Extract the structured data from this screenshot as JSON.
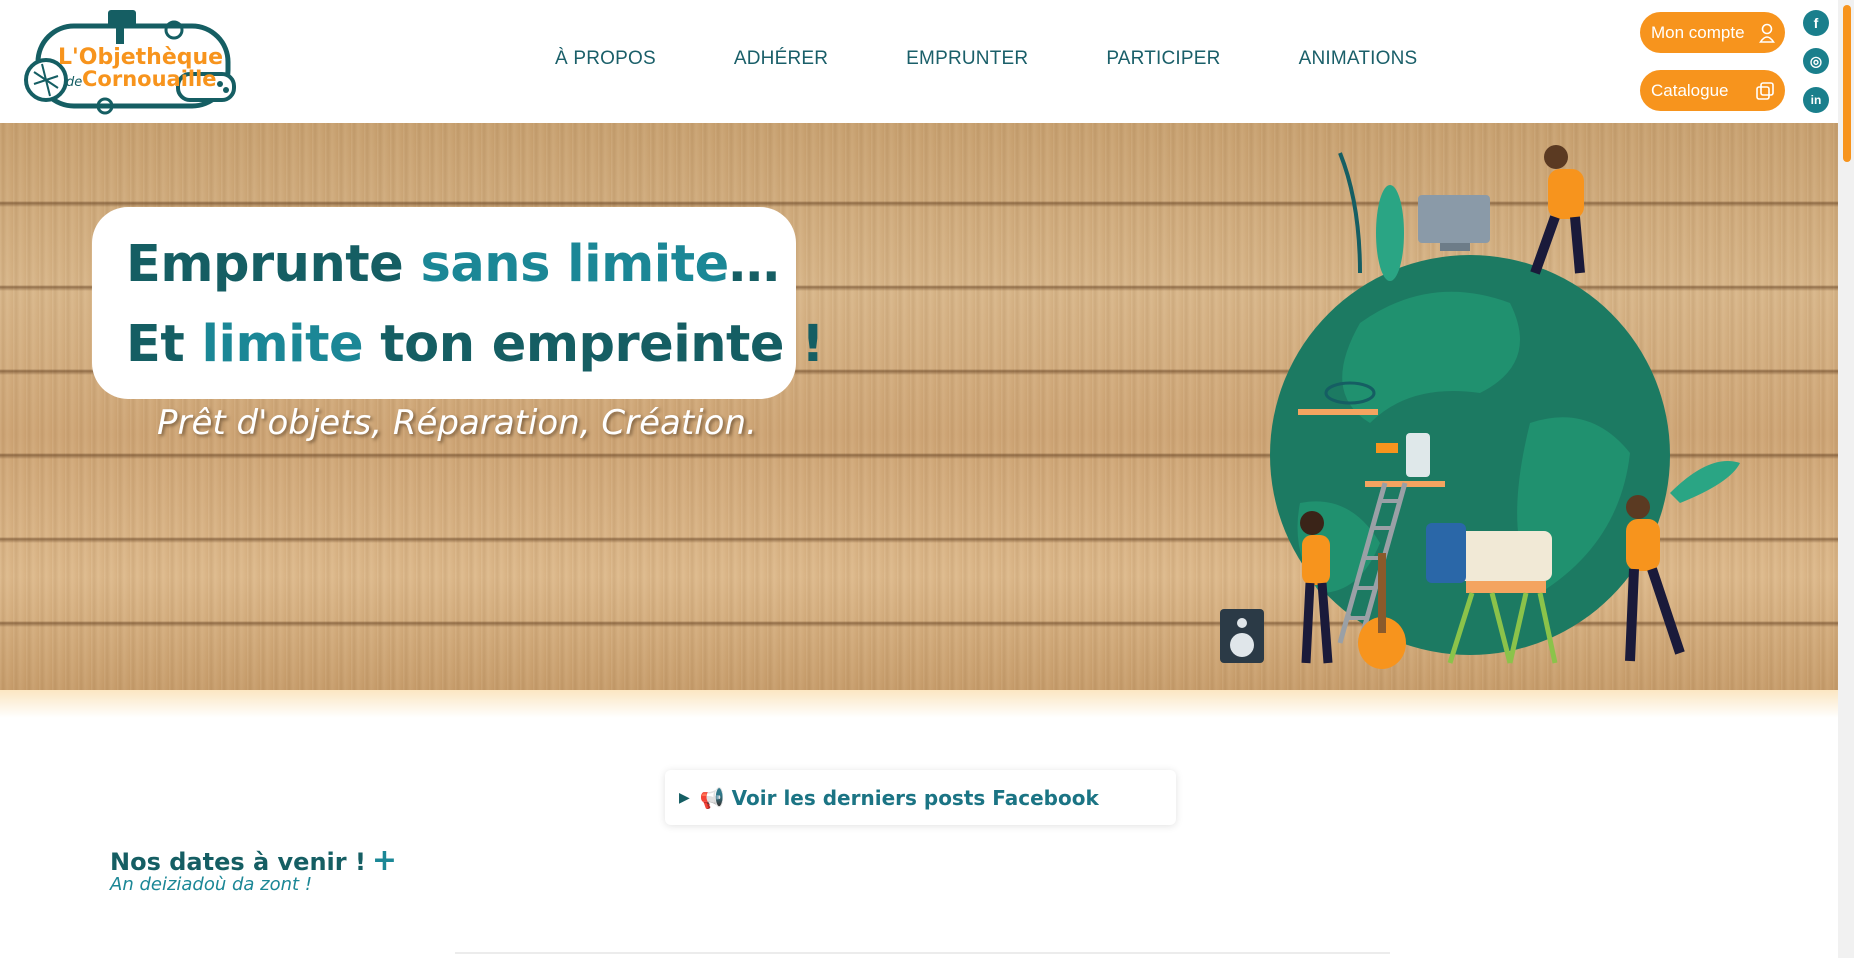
{
  "header": {
    "logo": {
      "line1": "L'Objethèque",
      "line2": "de",
      "line3": "Cornouaille"
    },
    "nav": [
      {
        "label": "À PROPOS"
      },
      {
        "label": "ADHÉRER"
      },
      {
        "label": "EMPRUNTER"
      },
      {
        "label": "PARTICIPER"
      },
      {
        "label": "ANIMATIONS"
      }
    ],
    "account_label": "Mon compte",
    "catalog_label": "Catalogue",
    "social": {
      "facebook": "f",
      "instagram": "◎",
      "linkedin": "in"
    }
  },
  "hero": {
    "line1": {
      "a": "Emprunte ",
      "b": "sans limite",
      "c": "…"
    },
    "line2": {
      "a": "Et ",
      "b": "limite",
      "c": " ton empreinte !"
    },
    "tagline": "Prêt d'objets, Réparation, Création."
  },
  "facebook": {
    "label": "📢 Voir les derniers posts Facebook"
  },
  "events": {
    "title": "Nos dates à venir !",
    "plus": "+",
    "subtitle": "An deiziadoù da zont !"
  },
  "colors": {
    "brand_teal": "#155e63",
    "accent_teal": "#1b8796",
    "orange": "#f7941d"
  }
}
